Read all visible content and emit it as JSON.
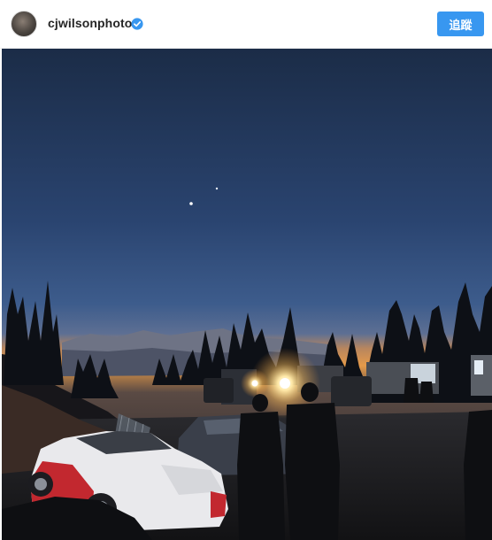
{
  "post": {
    "username": "cjwilsonphoto",
    "verified": true,
    "follow_label": "追蹤"
  },
  "colors": {
    "follow_button": "#3897f0",
    "verified_badge": "#3897f0",
    "username_text": "#262626"
  },
  "icons": {
    "verified": "verified-badge-icon",
    "avatar": "profile-avatar"
  },
  "photo": {
    "scene": "night-sky-mountain-race-pits"
  }
}
